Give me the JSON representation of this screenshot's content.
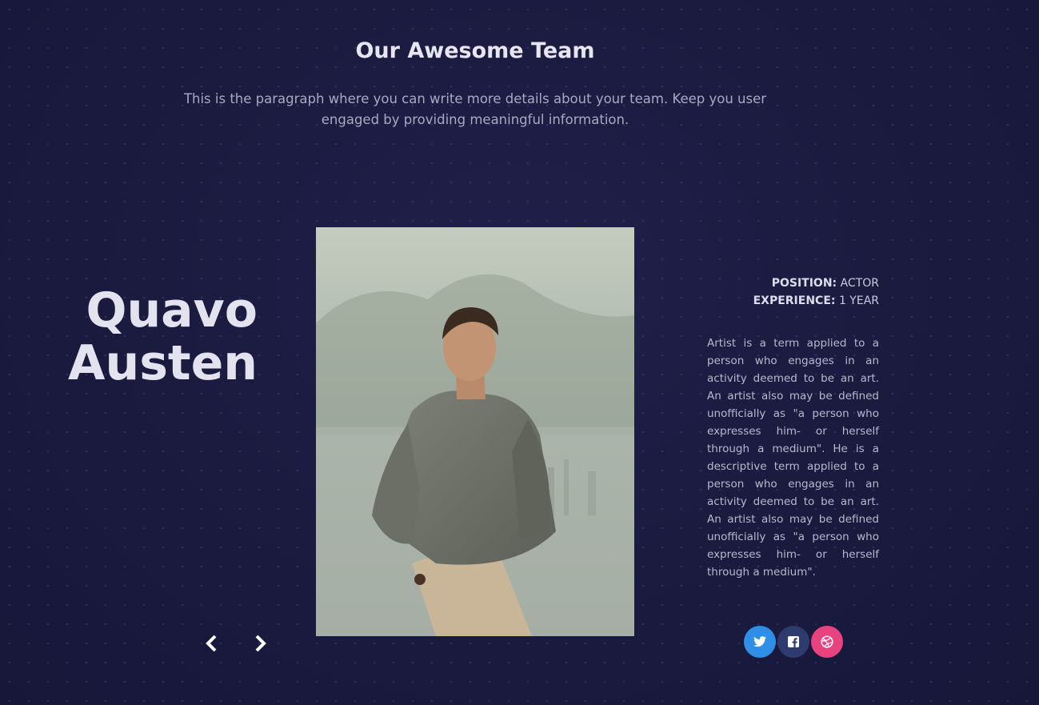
{
  "section": {
    "title": "Our Awesome Team",
    "description": "This is the paragraph where you can write more details about your team. Keep you user engaged by providing meaningful information."
  },
  "member": {
    "first_name": "Quavo",
    "last_name": "Austen",
    "position_label": "POSITION:",
    "position_value": "ACTOR",
    "experience_label": "EXPERIENCE:",
    "experience_value": "1 YEAR",
    "bio": "Artist is a term applied to a person who engages in an activity deemed to be an art. An artist also may be defined unofficially as \"a person who expresses him- or herself through a medium\". He is a descriptive term applied to a person who engages in an activity deemed to be an art. An artist also may be defined unofficially as \"a person who expresses him- or herself through a medium\"."
  },
  "icons": {
    "prev": "arrow-left-icon",
    "next": "arrow-right-icon",
    "twitter": "twitter-icon",
    "facebook": "facebook-icon",
    "dribbble": "dribbble-icon"
  },
  "colors": {
    "background": "#1a1a3d",
    "twitter": "#2f8fe6",
    "facebook": "#2d3b6e",
    "dribbble": "#e7437f"
  }
}
